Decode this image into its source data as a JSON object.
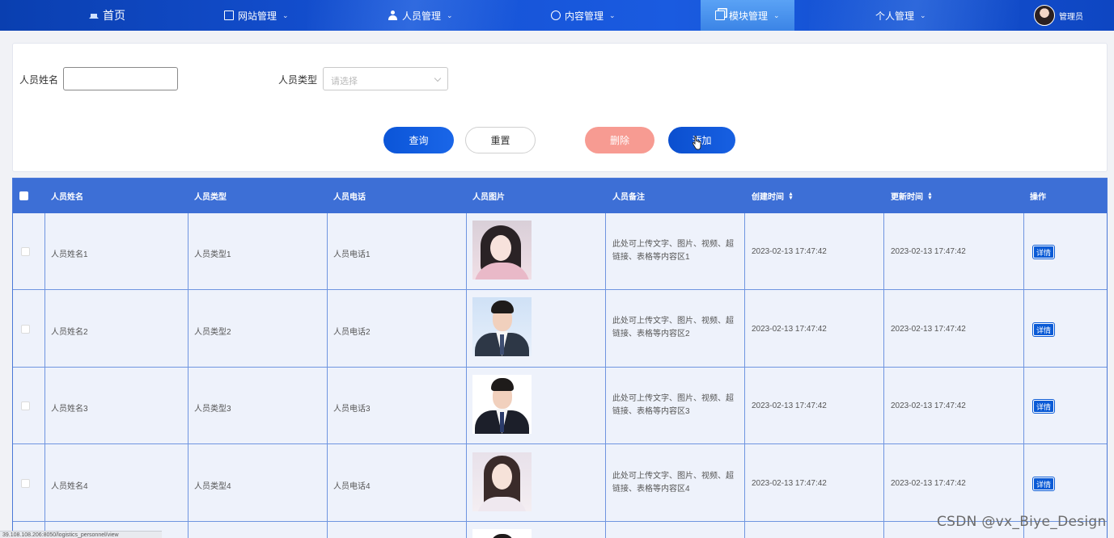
{
  "nav": {
    "home": "首页",
    "items": [
      {
        "label": "网站管理",
        "icon": "monitor-icon"
      },
      {
        "label": "人员管理",
        "icon": "user-icon"
      },
      {
        "label": "内容管理",
        "icon": "chat-icon"
      },
      {
        "label": "模块管理",
        "icon": "copy-icon",
        "active": true
      },
      {
        "label": "个人管理",
        "icon": ""
      }
    ],
    "admin": "管理员"
  },
  "search": {
    "name_label": "人员姓名",
    "name_value": "",
    "type_label": "人员类型",
    "type_placeholder": "请选择",
    "query": "查询",
    "reset": "重置",
    "delete": "删除",
    "add": "添加"
  },
  "table": {
    "columns": [
      "人员姓名",
      "人员类型",
      "人员电话",
      "人员图片",
      "人员备注",
      "创建时间",
      "更新时间",
      "操作"
    ],
    "rows": [
      {
        "name": "人员姓名1",
        "type": "人员类型1",
        "phone": "人员电话1",
        "note": "此处可上传文字、图片、视频、超链接、表格等内容区1",
        "created": "2023-02-13 17:47:42",
        "updated": "2023-02-13 17:47:42",
        "action": "详情"
      },
      {
        "name": "人员姓名2",
        "type": "人员类型2",
        "phone": "人员电话2",
        "note": "此处可上传文字、图片、视频、超链接、表格等内容区2",
        "created": "2023-02-13 17:47:42",
        "updated": "2023-02-13 17:47:42",
        "action": "详情"
      },
      {
        "name": "人员姓名3",
        "type": "人员类型3",
        "phone": "人员电话3",
        "note": "此处可上传文字、图片、视频、超链接、表格等内容区3",
        "created": "2023-02-13 17:47:42",
        "updated": "2023-02-13 17:47:42",
        "action": "详情"
      },
      {
        "name": "人员姓名4",
        "type": "人员类型4",
        "phone": "人员电话4",
        "note": "此处可上传文字、图片、视频、超链接、表格等内容区4",
        "created": "2023-02-13 17:47:42",
        "updated": "2023-02-13 17:47:42",
        "action": "详情"
      }
    ]
  },
  "statusbar": "39.108.108.206:8050/logistics_personnel/view",
  "watermark": "CSDN @vx_Biye_Design",
  "colors": {
    "nav": "#1551d4",
    "header": "#3d6fd6",
    "primary": "#0b55d8",
    "danger": "#f79b92"
  }
}
